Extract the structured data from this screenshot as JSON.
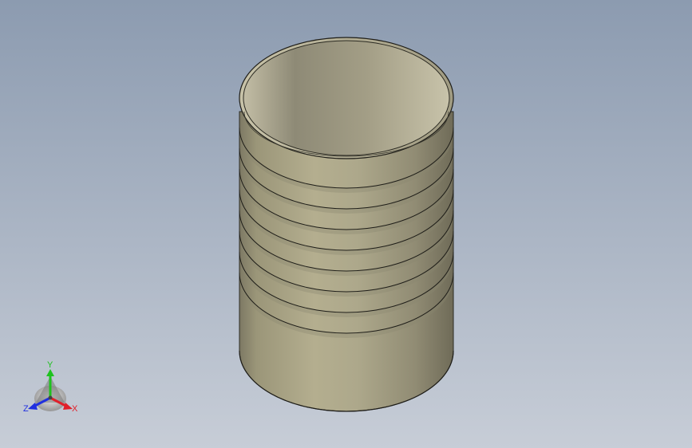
{
  "viewport": {
    "background_top": "#8d9cb0",
    "background_bottom": "#c6ccd6"
  },
  "model": {
    "body_color": "#a9a487",
    "inner_color": "#b8b399",
    "thread_count": 8
  },
  "triad": {
    "x_label": "X",
    "y_label": "Y",
    "z_label": "Z",
    "x_color": "#e0202a",
    "y_color": "#1ec21e",
    "z_color": "#2030e0"
  }
}
